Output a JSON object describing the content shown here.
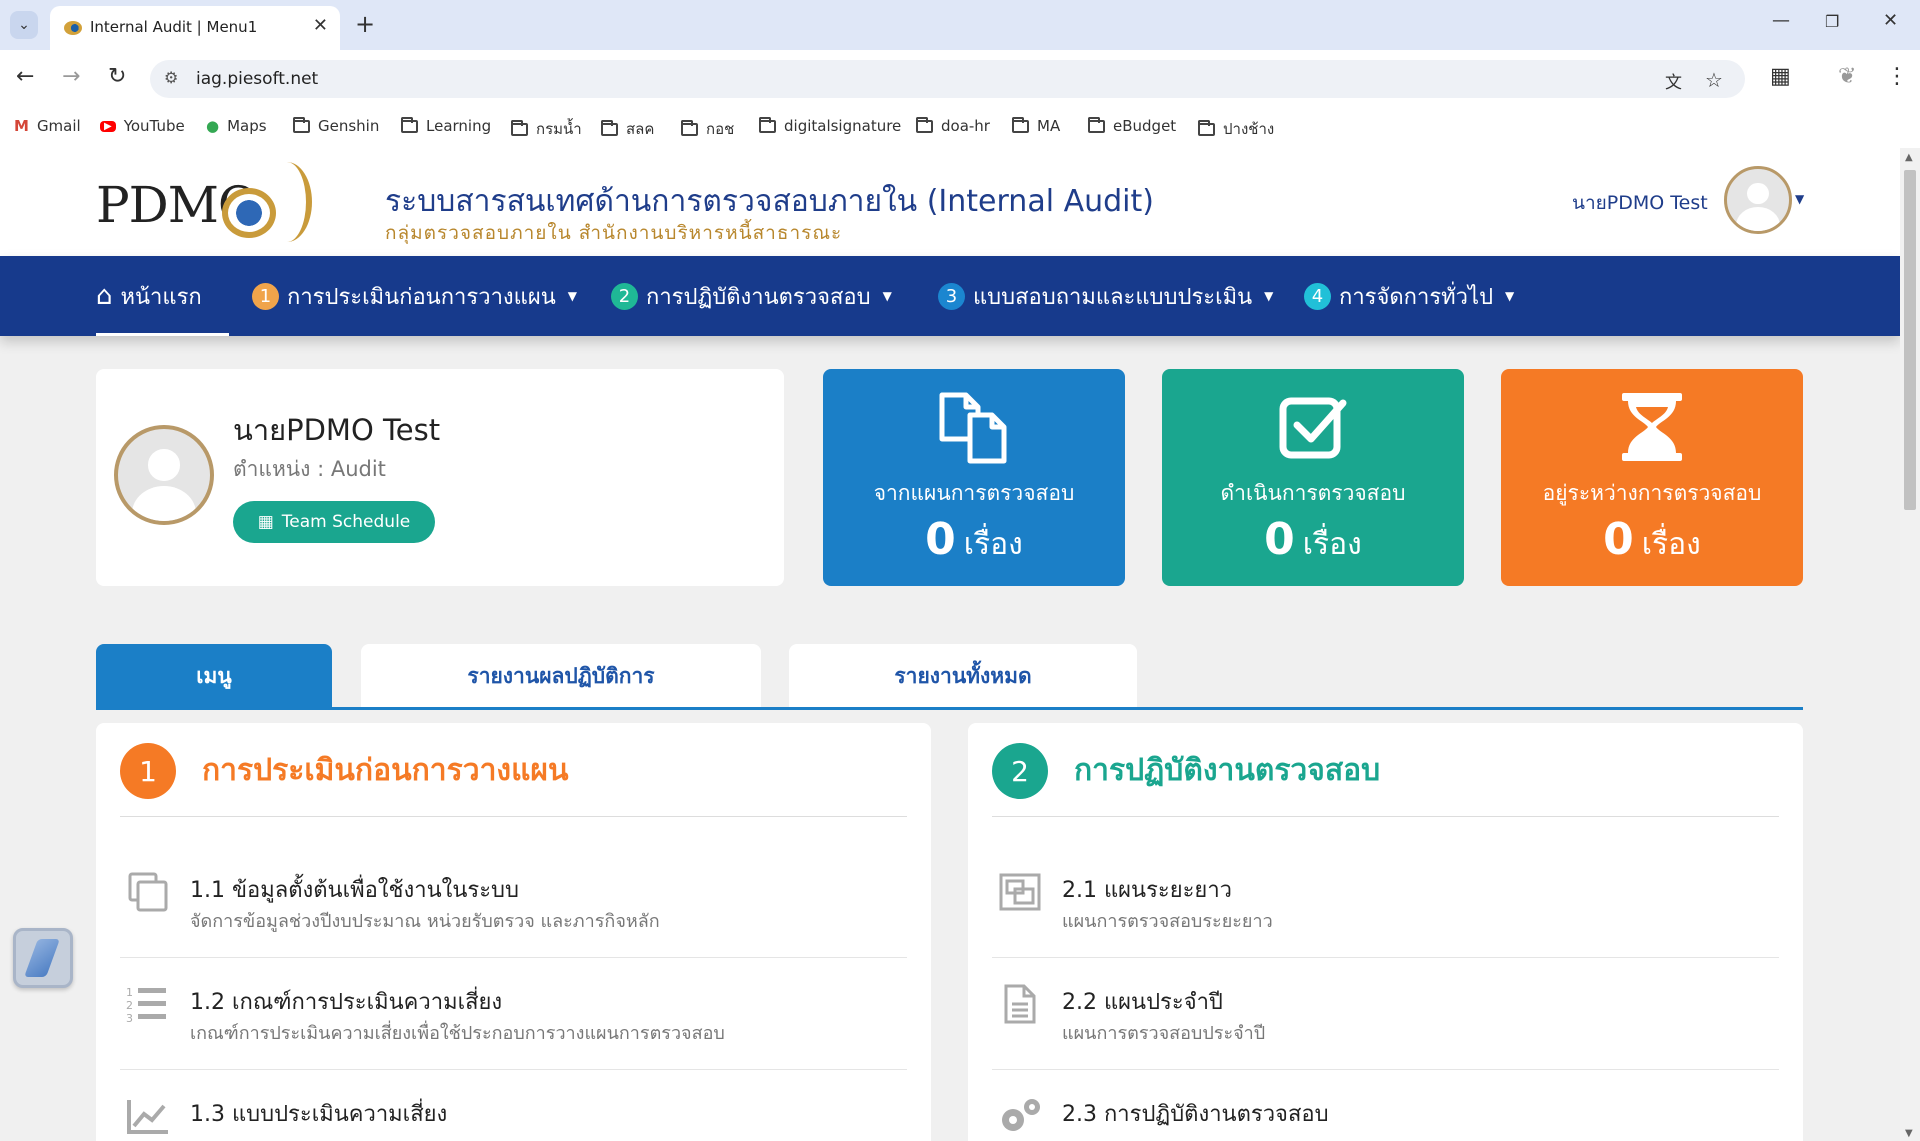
{
  "browser": {
    "tab_title": "Internal Audit | Menu1",
    "url": "iag.piesoft.net",
    "bookmarks": [
      "Gmail",
      "YouTube",
      "Maps",
      "Genshin",
      "Learning",
      "กรมน้ำ",
      "สลค",
      "กอช",
      "digitalsignature",
      "doa-hr",
      "MA",
      "eBudget",
      "ปางช้าง"
    ]
  },
  "header": {
    "logo_text": "PDMO",
    "title": "ระบบสารสนเทศด้านการตรวจสอบภายใน (Internal Audit)",
    "subtitle": "กลุ่มตรวจสอบภายใน สำนักงานบริหารหนี้สาธารณะ",
    "user_name": "นายPDMO Test"
  },
  "nav": {
    "home_label": "หน้าแรก",
    "items": [
      {
        "num": "1",
        "label": "การประเมินก่อนการวางแผน",
        "color": "#f0a44b"
      },
      {
        "num": "2",
        "label": "การปฏิบัติงานตรวจสอบ",
        "color": "#1fb896"
      },
      {
        "num": "3",
        "label": "แบบสอบถามและแบบประเมิน",
        "color": "#1b86d0"
      },
      {
        "num": "4",
        "label": "การจัดการทั่วไป",
        "color": "#21c0d8"
      }
    ]
  },
  "profile": {
    "name": "นายPDMO Test",
    "position": "ตำแหน่ง : Audit",
    "team_button": "Team Schedule"
  },
  "stats": [
    {
      "label": "จากแผนการตรวจสอบ",
      "value": "0",
      "unit": "เรื่อง",
      "color": "#1b7fc7",
      "icon": "files-icon"
    },
    {
      "label": "ดำเนินการตรวจสอบ",
      "value": "0",
      "unit": "เรื่อง",
      "color": "#1aa68f",
      "icon": "checkbox-icon"
    },
    {
      "label": "อยู่ระหว่างการตรวจสอบ",
      "value": "0",
      "unit": "เรื่อง",
      "color": "#f57a25",
      "icon": "hourglass-icon"
    }
  ],
  "tabs": [
    "เมนู",
    "รายงานผลปฏิบัติการ",
    "รายงานทั้งหมด"
  ],
  "panels": [
    {
      "num": "1",
      "title": "การประเมินก่อนการวางแผน",
      "color": "#f57a25",
      "items": [
        {
          "title": "1.1 ข้อมูลตั้งต้นเพื่อใช้งานในระบบ",
          "subtitle": "จัดการข้อมูลช่วงปีงบประมาณ หน่วยรับตรวจ และภารกิจหลัก",
          "icon": "copy-icon"
        },
        {
          "title": "1.2 เกณฑ์การประเมินความเสี่ยง",
          "subtitle": "เกณฑ์การประเมินความเสี่ยงเพื่อใช้ประกอบการวางแผนการตรวจสอบ",
          "icon": "list-ol-icon"
        },
        {
          "title": "1.3 แบบประเมินความเสี่ยง",
          "subtitle": "",
          "icon": "line-chart-icon"
        }
      ]
    },
    {
      "num": "2",
      "title": "การปฏิบัติงานตรวจสอบ",
      "color": "#1aa68f",
      "items": [
        {
          "title": "2.1 แผนระยะยาว",
          "subtitle": "แผนการตรวจสอบระยะยาว",
          "icon": "object-group-icon"
        },
        {
          "title": "2.2 แผนประจำปี",
          "subtitle": "แผนการตรวจสอบประจำปี",
          "icon": "document-icon"
        },
        {
          "title": "2.3 การปฏิบัติงานตรวจสอบ",
          "subtitle": "",
          "icon": "gears-icon"
        }
      ]
    }
  ]
}
